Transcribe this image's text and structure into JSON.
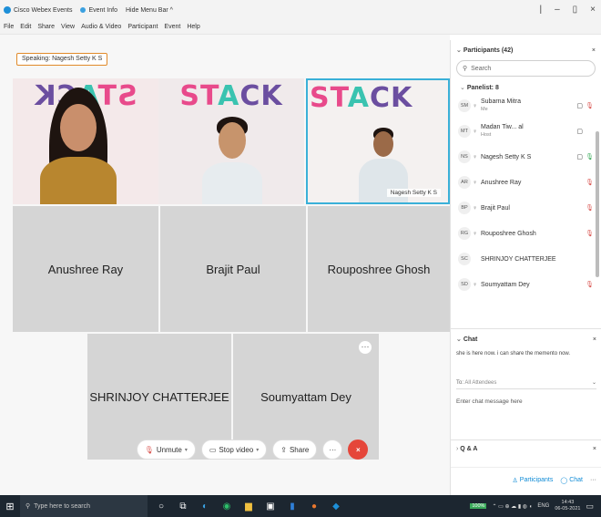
{
  "titlebar": {
    "items": [
      "Cisco Webex Events",
      "Event Info",
      "Hide Menu Bar ^"
    ]
  },
  "menubar": {
    "items": [
      "File",
      "Edit",
      "Share",
      "View",
      "Audio & Video",
      "Participant",
      "Event",
      "Help"
    ]
  },
  "stage": {
    "speaking": "Speaking: Nagesh Setty K S",
    "video_tiles": [
      {
        "banner": "STACK",
        "mirrored": true
      },
      {
        "banner": "STACK",
        "mirrored": false
      },
      {
        "banner": "STACK",
        "mirrored": false,
        "label": "Nagesh Setty K S",
        "active": true
      }
    ],
    "name_tiles": [
      "Anushree Ray",
      "Brajit Paul",
      "Rouposhree Ghosh",
      "SHRINJOY CHATTERJEE",
      "Soumyattam Dey"
    ]
  },
  "controls": {
    "unmute": "Unmute",
    "stop_video": "Stop video",
    "share": "Share",
    "more": "···",
    "end": "×"
  },
  "participants": {
    "title": "Participants (42)",
    "search_placeholder": "Search",
    "group": "Panelist: 8",
    "rows": [
      {
        "initials": "SM",
        "name": "Subarna Mitra",
        "sub": "Me",
        "cam": true,
        "mic": "muted"
      },
      {
        "initials": "MT",
        "name": "Madan Tiw...    al",
        "sub": "Host",
        "cam": true,
        "mic": "none"
      },
      {
        "initials": "NS",
        "name": "Nagesh Setty K S",
        "sub": "",
        "cam": true,
        "mic": "on"
      },
      {
        "initials": "AR",
        "name": "Anushree Ray",
        "sub": "",
        "cam": false,
        "mic": "muted"
      },
      {
        "initials": "BP",
        "name": "Brajit Paul",
        "sub": "",
        "cam": false,
        "mic": "muted"
      },
      {
        "initials": "RG",
        "name": "Rouposhree Ghosh",
        "sub": "",
        "cam": false,
        "mic": "muted"
      },
      {
        "initials": "SC",
        "name": "SHRINJOY CHATTERJEE",
        "sub": "",
        "cam": false,
        "mic": "none"
      },
      {
        "initials": "SD",
        "name": "Soumyattam Dey",
        "sub": "",
        "cam": false,
        "mic": "muted"
      }
    ]
  },
  "chat": {
    "title": "Chat",
    "message": "she is here now. i can share the memento now.",
    "to_label": "To:",
    "to_value": "All Attendees",
    "input_placeholder": "Enter chat message here"
  },
  "qa": {
    "title": "Q & A"
  },
  "footer": {
    "participants": "Participants",
    "chat": "Chat"
  },
  "taskbar": {
    "search": "Type here to search",
    "battery": "100%",
    "lang": "ENG",
    "time": "14:43",
    "date": "06-05-2021"
  },
  "colors": {
    "accent": "#0f8bd6",
    "end_call": "#e5463a",
    "speaker_border": "#3ab0d8",
    "tile_gray": "#d5d5d5"
  }
}
